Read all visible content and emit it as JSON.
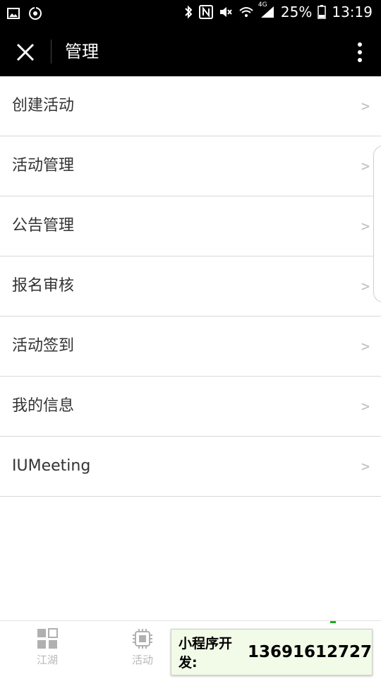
{
  "status_bar": {
    "battery_percent": "25%",
    "time": "13:19",
    "network": "4G",
    "left_icons": [
      "image-icon",
      "sync-icon"
    ],
    "right_icons": [
      "bluetooth-icon",
      "nfc-icon",
      "mute-icon",
      "wifi-icon",
      "signal-icon",
      "battery-icon"
    ]
  },
  "header": {
    "title": "管理",
    "close_icon": "close-icon",
    "more_icon": "more-vertical-icon"
  },
  "menu": {
    "items": [
      {
        "label": "创建活动",
        "chevron": ">"
      },
      {
        "label": "活动管理",
        "chevron": ">"
      },
      {
        "label": "公告管理",
        "chevron": ">"
      },
      {
        "label": "报名审核",
        "chevron": ">"
      },
      {
        "label": "活动签到",
        "chevron": ">"
      },
      {
        "label": "我的信息",
        "chevron": ">"
      },
      {
        "label": "IUMeeting",
        "chevron": ">"
      }
    ]
  },
  "tabbar": {
    "tabs": [
      {
        "label": "江湖",
        "icon": "grid-icon"
      },
      {
        "label": "活动",
        "icon": "chip-icon"
      }
    ],
    "active_color": "#1aad19",
    "inactive_color": "#b8b8b8"
  },
  "dev_banner": {
    "label": "小程序开发:",
    "phone": "13691612727"
  }
}
